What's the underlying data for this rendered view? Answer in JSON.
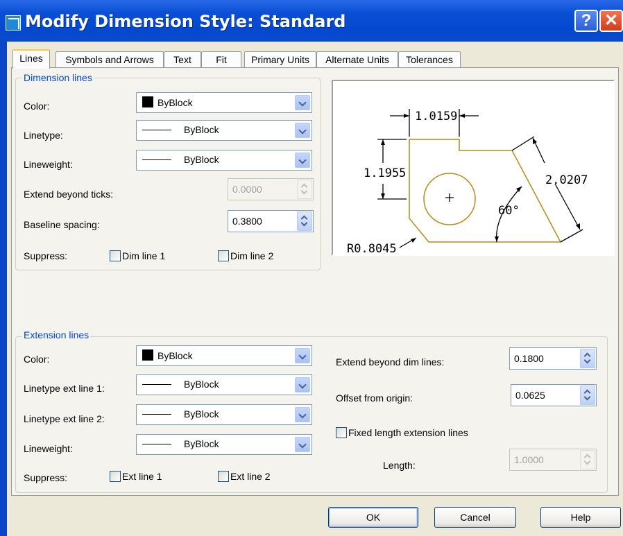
{
  "window": {
    "title": "Modify Dimension Style: Standard",
    "help_glyph": "?",
    "close_glyph": "✕"
  },
  "tabs": [
    {
      "label": "Lines",
      "active": true
    },
    {
      "label": "Symbols and Arrows",
      "active": false
    },
    {
      "label": "Text",
      "active": false
    },
    {
      "label": "Fit",
      "active": false
    },
    {
      "label": "Primary Units",
      "active": false
    },
    {
      "label": "Alternate Units",
      "active": false
    },
    {
      "label": "Tolerances",
      "active": false
    }
  ],
  "dimension_lines": {
    "legend": "Dimension lines",
    "color_label": "Color:",
    "color_value": "ByBlock",
    "linetype_label": "Linetype:",
    "linetype_value": "ByBlock",
    "lineweight_label": "Lineweight:",
    "lineweight_value": "ByBlock",
    "extend_label": "Extend beyond ticks:",
    "extend_value": "0.0000",
    "baseline_label": "Baseline spacing:",
    "baseline_value": "0.3800",
    "suppress_label": "Suppress:",
    "dim_line_1": "Dim line 1",
    "dim_line_2": "Dim line 2"
  },
  "extension_lines": {
    "legend": "Extension lines",
    "color_label": "Color:",
    "color_value": "ByBlock",
    "linetype1_label": "Linetype ext line 1:",
    "linetype1_value": "ByBlock",
    "linetype2_label": "Linetype ext line 2:",
    "linetype2_value": "ByBlock",
    "lineweight_label": "Lineweight:",
    "lineweight_value": "ByBlock",
    "suppress_label": "Suppress:",
    "ext_line_1": "Ext line 1",
    "ext_line_2": "Ext line 2",
    "extend_dim_label": "Extend beyond dim lines:",
    "extend_dim_value": "0.1800",
    "offset_label": "Offset from origin:",
    "offset_value": "0.0625",
    "fixed_label": "Fixed length extension lines",
    "length_label": "Length:",
    "length_value": "1.0000"
  },
  "preview": {
    "dim_top": "1.0159",
    "dim_left": "1.1955",
    "dim_right": "2.0207",
    "angle": "60°",
    "radius": "R0.8045"
  },
  "buttons": {
    "ok": "OK",
    "cancel": "Cancel",
    "help": "Help"
  },
  "colors": {
    "titlebar": "#0348d0",
    "accent_legend": "#0046d5",
    "preview_shape": "#b08c1c"
  }
}
